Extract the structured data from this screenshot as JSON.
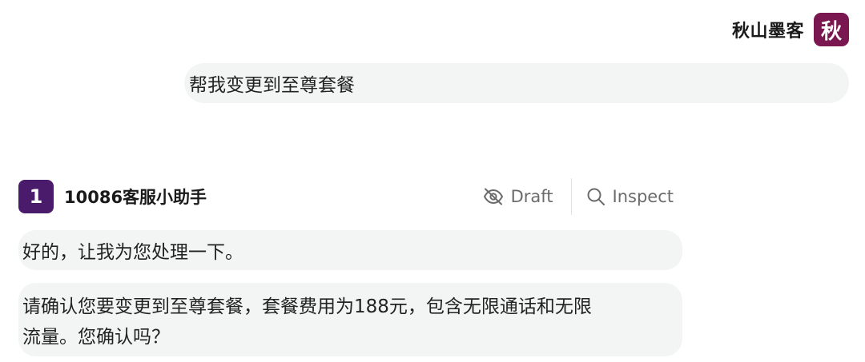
{
  "user": {
    "name": "秋山墨客",
    "avatar_char": "秋",
    "message": "帮我变更到至尊套餐"
  },
  "assistant": {
    "avatar_char": "1",
    "name": "10086客服小助手",
    "actions": {
      "draft_label": "Draft",
      "draft_icon": "eye-off-icon",
      "inspect_label": "Inspect",
      "inspect_icon": "search-icon"
    },
    "messages": [
      "好的，让我为您处理一下。",
      "请确认您要变更到至尊套餐，套餐费用为188元，包含无限通话和无限流量。您确认吗？"
    ]
  },
  "colors": {
    "user_avatar_bg": "#7a1650",
    "assistant_avatar_bg": "#4a1a6b",
    "bubble_bg": "#f3f5f4"
  }
}
